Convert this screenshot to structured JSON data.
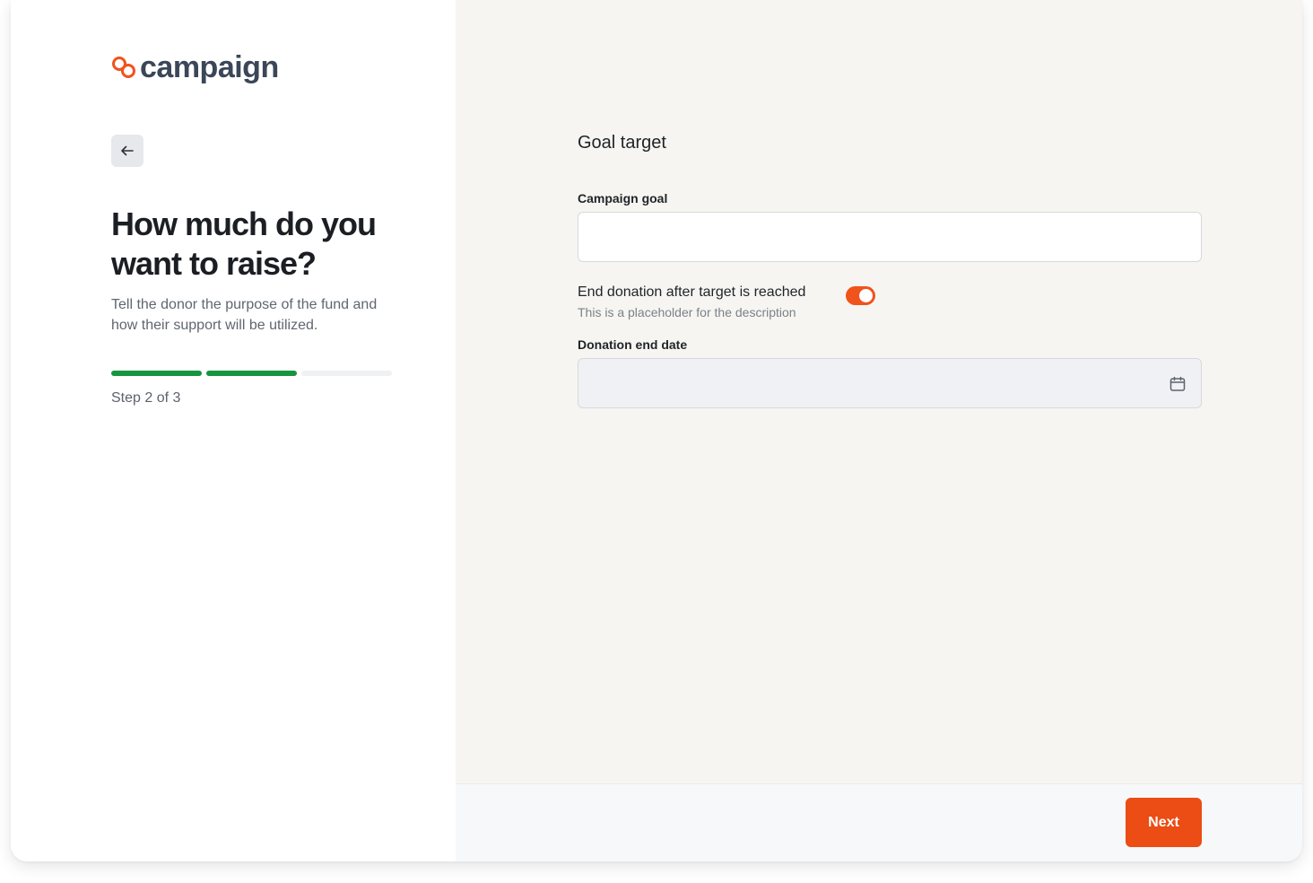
{
  "brand": {
    "name": "campaign",
    "accent": "#f0531c",
    "text_color": "#3b4658"
  },
  "left": {
    "back_icon": "arrow-left-icon",
    "heading": "How much do you want to raise?",
    "subtext": "Tell the donor the purpose of the fund and how their support will be utilized.",
    "progress": {
      "completed_steps": 2,
      "total_steps": 3,
      "color": "#16953f"
    },
    "step_label": "Step 2 of 3"
  },
  "form": {
    "section_title": "Goal target",
    "campaign_goal": {
      "label": "Campaign goal",
      "value": "",
      "placeholder": ""
    },
    "end_after_target": {
      "label": "End donation after target is reached",
      "description": "This is a placeholder for the description",
      "enabled": true
    },
    "end_date": {
      "label": "Donation end date",
      "value": "",
      "placeholder": "",
      "icon": "calendar-icon"
    }
  },
  "footer": {
    "next_label": "Next",
    "next_color": "#eb4d14"
  }
}
